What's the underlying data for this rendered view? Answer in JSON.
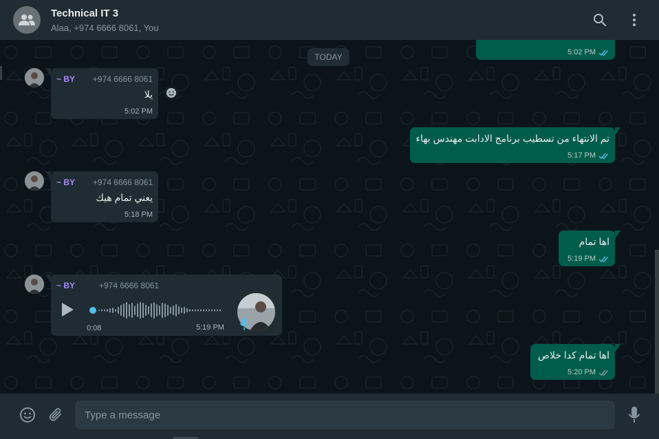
{
  "header": {
    "title": "Technical IT 3",
    "subtitle": "Alaa, +974 6666 8061, You",
    "icons": [
      "group-avatar-icon",
      "search-icon",
      "menu-dots-icon"
    ]
  },
  "chat": {
    "date_divider": "TODAY",
    "top_partial_time": "5:02 PM",
    "messages": [
      {
        "direction": "in",
        "sender": "~ BY",
        "phone": "+974 6666 8061",
        "text": "يلا",
        "time": "5:02 PM"
      },
      {
        "direction": "out",
        "text": "تم الانتهاء من تسطيب برنامج الادابت مهندس بهاء",
        "time": "5:17 PM"
      },
      {
        "direction": "in",
        "sender": "~ BY",
        "phone": "+974 6666 8061",
        "text": "يعني تمام هيك",
        "time": "5:18 PM"
      },
      {
        "direction": "out",
        "text": "اها تمام",
        "time": "5:19 PM"
      },
      {
        "direction": "in",
        "sender": "~ BY",
        "phone": "+974 6666 8061",
        "type": "voice",
        "duration": "0:08",
        "time": "5:19 PM"
      },
      {
        "direction": "out",
        "text": "اها تمام كدا خلاص",
        "time": "5:20 PM"
      }
    ]
  },
  "composer": {
    "placeholder": "Type a message",
    "icons": [
      "emoji-icon",
      "attach-icon",
      "microphone-icon"
    ]
  },
  "colors": {
    "background": "#0b141a",
    "panel": "#202c33",
    "incoming_bubble": "#1f2c33",
    "outgoing_bubble": "#005c4b",
    "read_ticks": "#53bdeb",
    "sender_name": "#a78bfa"
  }
}
